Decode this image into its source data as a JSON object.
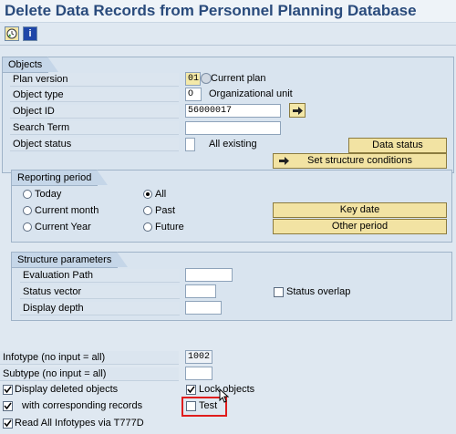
{
  "window": {
    "title": "Delete Data Records from Personnel Planning Database"
  },
  "toolbar": {
    "execute_icon": "clock-execute-icon",
    "info_icon": "info-icon",
    "info_label": "i"
  },
  "objects": {
    "group_title": "Objects",
    "plan_version_label": "Plan version",
    "plan_version_value": "01",
    "plan_version_text": "Current plan",
    "object_type_label": "Object type",
    "object_type_value": "O",
    "object_type_text": "Organizational unit",
    "object_id_label": "Object ID",
    "object_id_value": "56000017",
    "search_term_label": "Search Term",
    "search_term_value": "",
    "object_status_label": "Object status",
    "object_status_value": "",
    "object_status_text": "All existing",
    "data_status_button": "Data status",
    "structure_conditions_button": "Set structure conditions"
  },
  "reporting_period": {
    "group_title": "Reporting period",
    "options": {
      "today": "Today",
      "all": "All",
      "current_month": "Current month",
      "past": "Past",
      "current_year": "Current Year",
      "future": "Future"
    },
    "selected": "all",
    "key_date_button": "Key date",
    "other_period_button": "Other period"
  },
  "structure": {
    "group_title": "Structure parameters",
    "evaluation_path_label": "Evaluation Path",
    "evaluation_path_value": "",
    "status_vector_label": "Status vector",
    "status_vector_value": "",
    "status_overlap_label": "Status overlap",
    "status_overlap_checked": false,
    "display_depth_label": "Display depth",
    "display_depth_value": ""
  },
  "bottom": {
    "infotype_label": "Infotype (no input = all)",
    "infotype_value": "1002",
    "subtype_label": "Subtype (no input = all)",
    "subtype_value": "",
    "display_deleted_label": "Display deleted objects",
    "display_deleted_checked": true,
    "lock_objects_label": "Lock objects",
    "lock_objects_checked": true,
    "with_corresponding_label": "with corresponding records",
    "with_corresponding_checked": true,
    "test_label": "Test",
    "test_checked": false,
    "read_all_label": "Read All Infotypes via T777D",
    "read_all_checked": true
  },
  "colors": {
    "highlight": "#e01d1d",
    "button": "#f2e3a3",
    "title": "#2a4b7c"
  }
}
